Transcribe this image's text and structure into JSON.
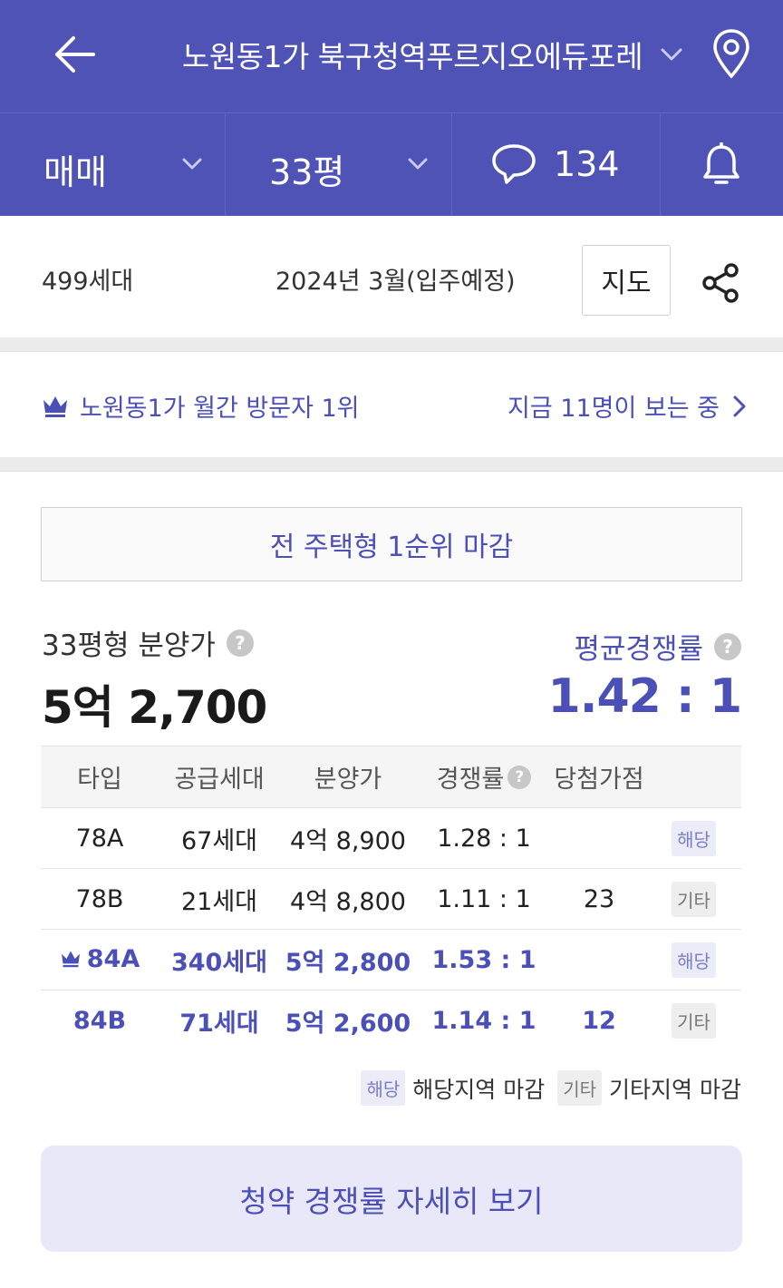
{
  "header": {
    "title": "노원동1가 북구청역푸르지오에듀포레",
    "icons": [
      "arrow-left-icon",
      "chevron-down-icon",
      "map-pin-icon"
    ]
  },
  "filters": {
    "trade_type": "매매",
    "size": "33평",
    "comment_count": "134"
  },
  "info": {
    "households": "499세대",
    "move_in": "2024년 3월(입주예정)",
    "map_button": "지도"
  },
  "ranking": {
    "text": "노원동1가 월간 방문자 1위",
    "viewers": "지금 11명이 보는 중"
  },
  "banner": "전 주택형 1순위 마감",
  "price": {
    "label": "33평형 분양가",
    "value": "5억 2,700",
    "competition_label": "평균경쟁률",
    "competition_value": "1.42 : 1"
  },
  "table": {
    "headers": [
      "타입",
      "공급세대",
      "분양가",
      "경쟁률",
      "당첨가점"
    ],
    "rows": [
      {
        "type": "78A",
        "units": "67세대",
        "price": "4억 8,900",
        "rate": "1.28 : 1",
        "score": "",
        "tag": "해당"
      },
      {
        "type": "78B",
        "units": "21세대",
        "price": "4억 8,800",
        "rate": "1.11 : 1",
        "score": "23",
        "tag": "기타"
      },
      {
        "type": "84A",
        "units": "340세대",
        "price": "5억 2,800",
        "rate": "1.53 : 1",
        "score": "",
        "tag": "해당"
      },
      {
        "type": "84B",
        "units": "71세대",
        "price": "5억 2,600",
        "rate": "1.14 : 1",
        "score": "12",
        "tag": "기타"
      }
    ]
  },
  "legend": {
    "local_tag": "해당",
    "local_text": "해당지역 마감",
    "other_tag": "기타",
    "other_text": "기타지역 마감"
  },
  "cta": "청약 경쟁률 자세히 보기",
  "colors": {
    "brand": "#4f53b6",
    "accent_text": "#4b4fb8",
    "cta_bg": "#e9e8f9"
  }
}
